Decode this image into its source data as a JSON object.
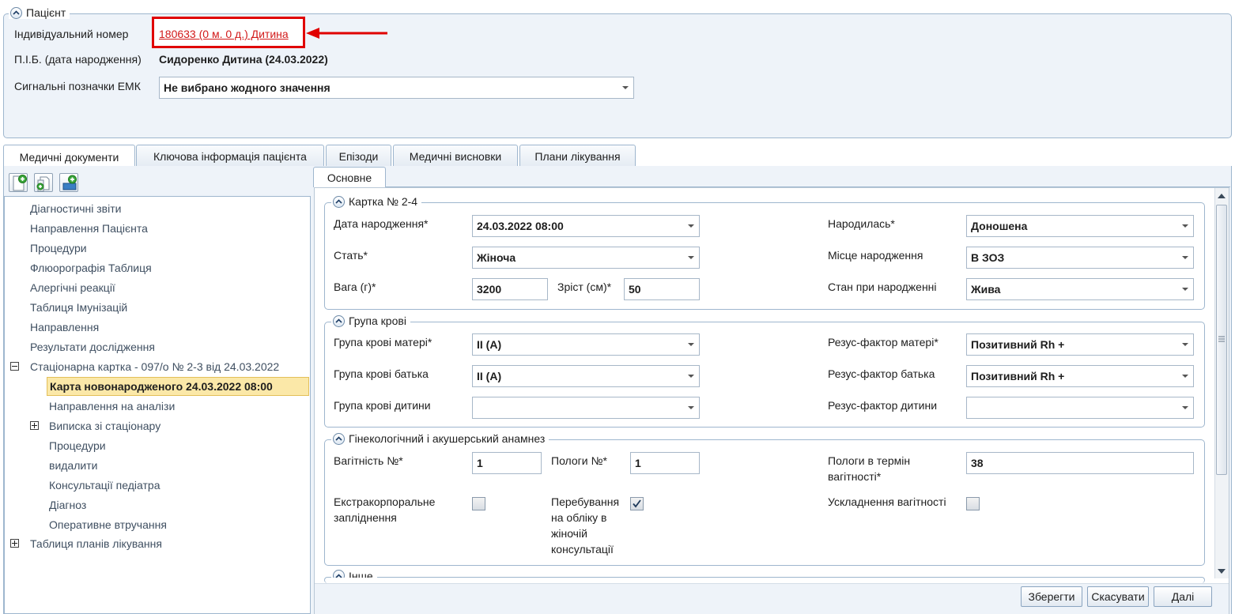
{
  "patient": {
    "legend": "Пацієнт",
    "id_label": "Індивідуальний номер",
    "id_value": "180633 (0 м. 0 д.) Дитина",
    "name_label": "П.І.Б. (дата народження)",
    "name_value": "Сидоренко Дитина (24.03.2022)",
    "signals_label": "Сигнальні позначки ЕМК",
    "signals_value": "Не вибрано жодного значення"
  },
  "tabs": [
    {
      "label": "Медичні документи"
    },
    {
      "label": "Ключова інформація пацієнта"
    },
    {
      "label": "Епізоди"
    },
    {
      "label": "Медичні висновки"
    },
    {
      "label": "Плани лікування"
    }
  ],
  "tree": {
    "items": [
      {
        "label": "Діагностичні звіти"
      },
      {
        "label": "Направлення Пацієнта"
      },
      {
        "label": "Процедури"
      },
      {
        "label": "Флюорографія Таблиця"
      },
      {
        "label": "Алергічні реакції"
      },
      {
        "label": "Таблиця Імунізацій"
      },
      {
        "label": "Направлення"
      },
      {
        "label": "Результати дослідження"
      },
      {
        "label": "Стаціонарна картка - 097/о № 2-3 від 24.03.2022"
      },
      {
        "label": "Карта новонародженого 24.03.2022 08:00"
      },
      {
        "label": "Направлення на аналізи"
      },
      {
        "label": "Виписка зі стаціонару"
      },
      {
        "label": "Процедури"
      },
      {
        "label": "видалити"
      },
      {
        "label": "Консультації педіатра"
      },
      {
        "label": "Діагноз"
      },
      {
        "label": "Оперативне втручання"
      },
      {
        "label": "Таблиця планів лікування"
      }
    ]
  },
  "subtab": {
    "label": "Основне"
  },
  "card": {
    "legend": "Картка № 2-4",
    "birth_date_label": "Дата народження*",
    "birth_date_value": "24.03.2022 08:00",
    "born_label": "Народилась*",
    "born_value": "Доношена",
    "sex_label": "Стать*",
    "sex_value": "Жіноча",
    "place_label": "Місце народження",
    "place_value": "В ЗОЗ",
    "weight_label": "Вага (г)*",
    "weight_value": "3200",
    "height_label": "Зріст (см)*",
    "height_value": "50",
    "state_label": "Стан при народженні",
    "state_value": "Жива"
  },
  "blood": {
    "legend": "Група крові",
    "mother_group_label": "Група крові матері*",
    "mother_group_value": "II (A)",
    "mother_rh_label": "Резус-фактор матері*",
    "mother_rh_value": "Позитивний Rh +",
    "father_group_label": "Група крові батька",
    "father_group_value": "II (A)",
    "father_rh_label": "Резус-фактор батька",
    "father_rh_value": "Позитивний Rh +",
    "child_group_label": "Група крові дитини",
    "child_group_value": "",
    "child_rh_label": "Резус-фактор дитини",
    "child_rh_value": ""
  },
  "anamnesis": {
    "legend": "Гінекологічний і акушерський анамнез",
    "pregnancy_label": "Вагітність №*",
    "pregnancy_value": "1",
    "labor_label": "Пологи №*",
    "labor_value": "1",
    "term_label": "Пологи в термін вагітності*",
    "term_value": "38",
    "eco_label": "Екстракорпоральне запліднення",
    "eco_checked": false,
    "registered_label": "Перебування на обліку в жіночій консультації",
    "registered_checked": true,
    "complications_label": "Ускладнення вагітності",
    "complications_checked": false
  },
  "other": {
    "legend": "Інше"
  },
  "buttons": {
    "save": "Зберегти",
    "cancel": "Скасувати",
    "next": "Далі"
  },
  "colors": {
    "accent_blue": "#9eb6ce",
    "panel_bg": "#eef3f9",
    "selected_bg": "#fbe8a8",
    "link_red": "#d21a1a",
    "highlight_red": "#e00000"
  }
}
